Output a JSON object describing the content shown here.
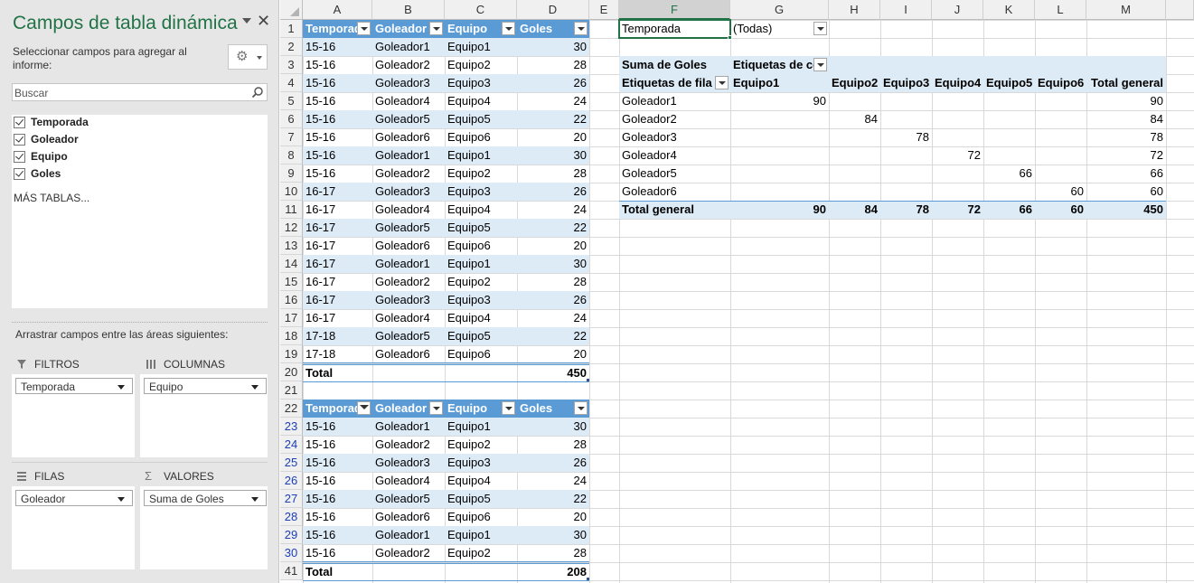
{
  "pane": {
    "title": "Campos de tabla dinámica",
    "subtitle": "Seleccionar campos para agregar al informe:",
    "search_placeholder": "Buscar",
    "fields": [
      {
        "label": "Temporada",
        "checked": true
      },
      {
        "label": "Goleador",
        "checked": true
      },
      {
        "label": "Equipo",
        "checked": true
      },
      {
        "label": "Goles",
        "checked": true
      }
    ],
    "more_tables": "MÁS TABLAS...",
    "drag_label": "Arrastrar campos entre las áreas siguientes:",
    "areas": {
      "filters": {
        "title": "FILTROS",
        "field": "Temporada"
      },
      "columns": {
        "title": "COLUMNAS",
        "field": "Equipo"
      },
      "rows": {
        "title": "FILAS",
        "field": "Goleador"
      },
      "values": {
        "title": "VALORES",
        "field": "Suma de Goles"
      }
    }
  },
  "sheet": {
    "columns": [
      "A",
      "B",
      "C",
      "D",
      "E",
      "F",
      "G",
      "H",
      "I",
      "J",
      "K",
      "L",
      "M"
    ],
    "selected_column": "F",
    "row_numbers": [
      "1",
      "2",
      "3",
      "4",
      "5",
      "6",
      "7",
      "8",
      "9",
      "10",
      "11",
      "12",
      "13",
      "14",
      "15",
      "16",
      "17",
      "18",
      "19",
      "20",
      "21",
      "22",
      "23",
      "24",
      "25",
      "26",
      "27",
      "28",
      "29",
      "30",
      "41"
    ],
    "filtered_row_numbers": [
      "23",
      "24",
      "25",
      "26",
      "27",
      "28",
      "29",
      "30"
    ],
    "table1": {
      "headers": [
        "Temporada",
        "Goleador",
        "Equipo",
        "Goles"
      ],
      "rows": [
        [
          "15-16",
          "Goleador1",
          "Equipo1",
          "30"
        ],
        [
          "15-16",
          "Goleador2",
          "Equipo2",
          "28"
        ],
        [
          "15-16",
          "Goleador3",
          "Equipo3",
          "26"
        ],
        [
          "15-16",
          "Goleador4",
          "Equipo4",
          "24"
        ],
        [
          "15-16",
          "Goleador5",
          "Equipo5",
          "22"
        ],
        [
          "15-16",
          "Goleador6",
          "Equipo6",
          "20"
        ],
        [
          "15-16",
          "Goleador1",
          "Equipo1",
          "30"
        ],
        [
          "15-16",
          "Goleador2",
          "Equipo2",
          "28"
        ],
        [
          "16-17",
          "Goleador3",
          "Equipo3",
          "26"
        ],
        [
          "16-17",
          "Goleador4",
          "Equipo4",
          "24"
        ],
        [
          "16-17",
          "Goleador5",
          "Equipo5",
          "22"
        ],
        [
          "16-17",
          "Goleador6",
          "Equipo6",
          "20"
        ],
        [
          "16-17",
          "Goleador1",
          "Equipo1",
          "30"
        ],
        [
          "16-17",
          "Goleador2",
          "Equipo2",
          "28"
        ],
        [
          "16-17",
          "Goleador3",
          "Equipo3",
          "26"
        ],
        [
          "16-17",
          "Goleador4",
          "Equipo4",
          "24"
        ],
        [
          "17-18",
          "Goleador5",
          "Equipo5",
          "22"
        ],
        [
          "17-18",
          "Goleador6",
          "Equipo6",
          "20"
        ]
      ],
      "total_label": "Total",
      "total_value": "450"
    },
    "table2": {
      "headers": [
        "Temporada",
        "Goleador",
        "Equipo",
        "Goles"
      ],
      "rows": [
        [
          "15-16",
          "Goleador1",
          "Equipo1",
          "30"
        ],
        [
          "15-16",
          "Goleador2",
          "Equipo2",
          "28"
        ],
        [
          "15-16",
          "Goleador3",
          "Equipo3",
          "26"
        ],
        [
          "15-16",
          "Goleador4",
          "Equipo4",
          "24"
        ],
        [
          "15-16",
          "Goleador5",
          "Equipo5",
          "22"
        ],
        [
          "15-16",
          "Goleador6",
          "Equipo6",
          "20"
        ],
        [
          "15-16",
          "Goleador1",
          "Equipo1",
          "30"
        ],
        [
          "15-16",
          "Goleador2",
          "Equipo2",
          "28"
        ]
      ],
      "total_label": "Total",
      "total_value": "208"
    },
    "pivot": {
      "filter_label": "Temporada",
      "filter_value": "(Todas)",
      "values_label": "Suma de Goles",
      "col_labels_caption": "Etiquetas de columna",
      "row_labels_caption": "Etiquetas de fila",
      "col_headers": [
        "Equipo1",
        "Equipo2",
        "Equipo3",
        "Equipo4",
        "Equipo5",
        "Equipo6",
        "Total general"
      ],
      "rows": [
        {
          "label": "Goleador1",
          "values": [
            "90",
            "",
            "",
            "",
            "",
            "",
            "90"
          ]
        },
        {
          "label": "Goleador2",
          "values": [
            "",
            "84",
            "",
            "",
            "",
            "",
            "84"
          ]
        },
        {
          "label": "Goleador3",
          "values": [
            "",
            "",
            "78",
            "",
            "",
            "",
            "78"
          ]
        },
        {
          "label": "Goleador4",
          "values": [
            "",
            "",
            "",
            "72",
            "",
            "",
            "72"
          ]
        },
        {
          "label": "Goleador5",
          "values": [
            "",
            "",
            "",
            "",
            "66",
            "",
            "66"
          ]
        },
        {
          "label": "Goleador6",
          "values": [
            "",
            "",
            "",
            "",
            "",
            "60",
            "60"
          ]
        }
      ],
      "total_label": "Total general",
      "totals": [
        "90",
        "84",
        "78",
        "72",
        "66",
        "60",
        "450"
      ]
    }
  },
  "colors": {
    "accent": "#217346",
    "table_header": "#5b9bd5",
    "table_band": "#ddebf7"
  }
}
